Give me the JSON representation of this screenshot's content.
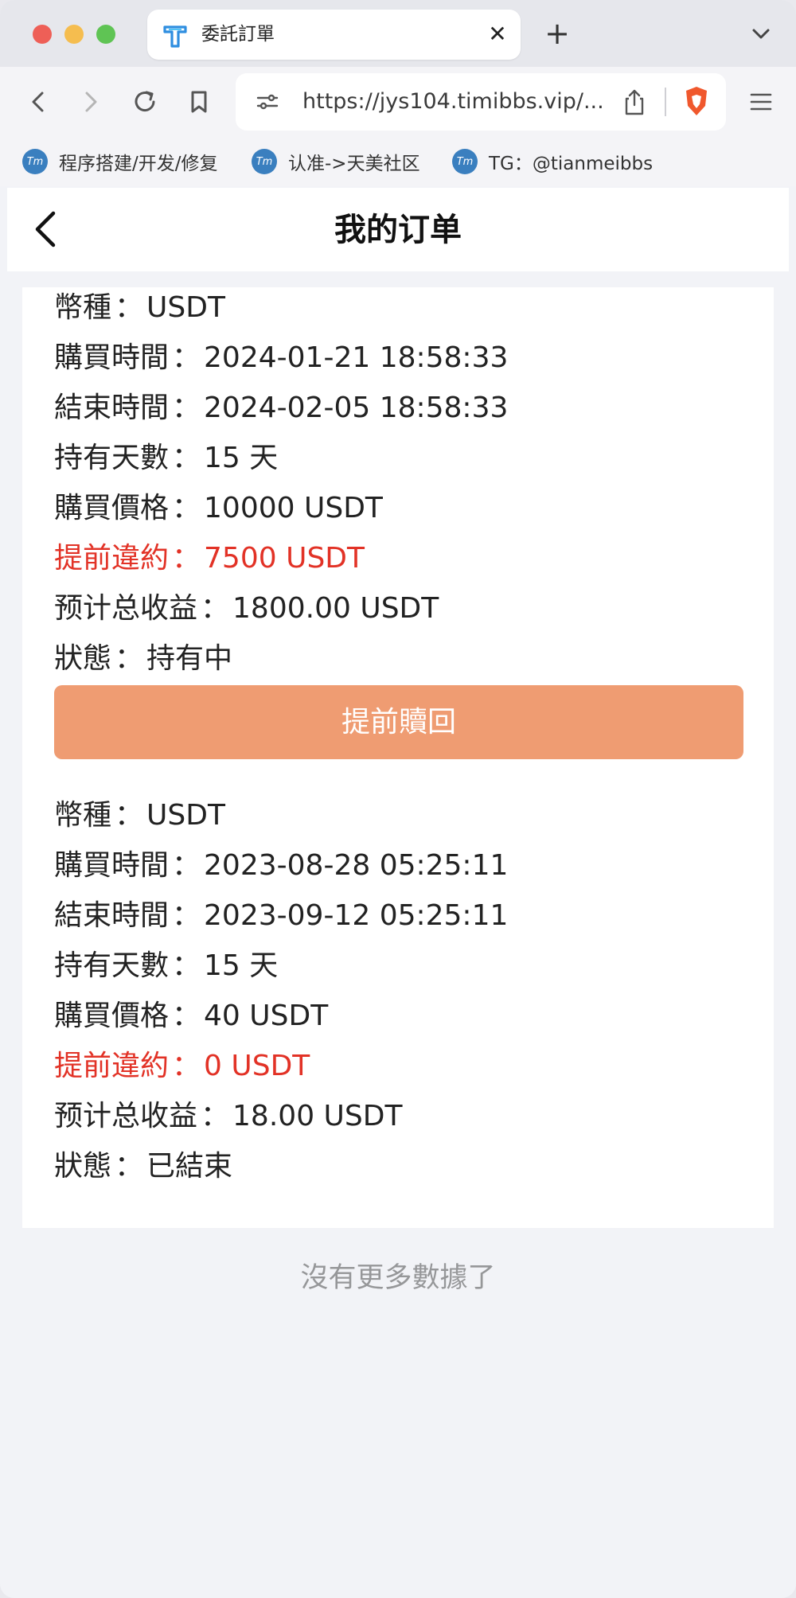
{
  "browser": {
    "tab_title": "委託訂單",
    "url": "https://jys104.timibbs.vip/...",
    "bookmarks": [
      {
        "label": "程序搭建/开发/修复"
      },
      {
        "label": "认准->天美社区"
      },
      {
        "label": "TG：@tianmeibbs"
      }
    ],
    "bookmark_icon_text": "Tm",
    "colors": {
      "red": "#ee5f57",
      "yellow": "#f5bd4f",
      "green": "#5fc454",
      "brave": "#f0582d"
    }
  },
  "page": {
    "title": "我的订单",
    "no_more": "沒有更多數據了",
    "accent": "#ef9c72",
    "warning_color": "#e23226"
  },
  "labels": {
    "currency": "幣種",
    "buy_time": "購買時間",
    "end_time": "結束時間",
    "hold_days": "持有天數",
    "buy_price": "購買價格",
    "early_penalty": "提前違約",
    "expected_income": "预计总收益",
    "status": "狀態",
    "colon": "："
  },
  "orders": [
    {
      "currency": "USDT",
      "buy_time": "2024-01-21 18:58:33",
      "end_time": "2024-02-05 18:58:33",
      "hold_days": "15 天",
      "buy_price": "10000 USDT",
      "early_penalty": "7500 USDT",
      "expected_income": "1800.00 USDT",
      "status": "持有中",
      "redeem_label": "提前贖回"
    },
    {
      "currency": "USDT",
      "buy_time": "2023-08-28 05:25:11",
      "end_time": "2023-09-12 05:25:11",
      "hold_days": "15 天",
      "buy_price": "40 USDT",
      "early_penalty": "0 USDT",
      "expected_income": "18.00 USDT",
      "status": "已結束"
    }
  ]
}
